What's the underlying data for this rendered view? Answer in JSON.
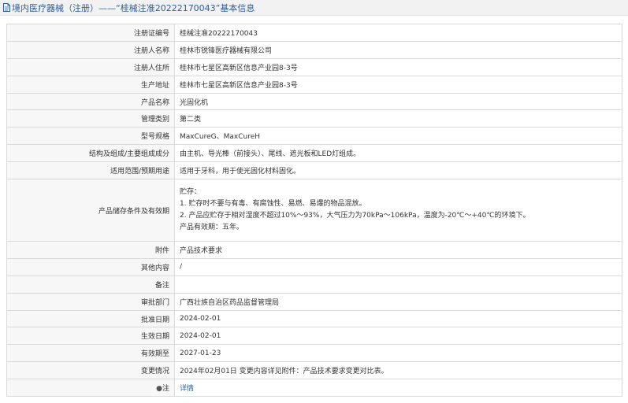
{
  "header": {
    "title": "境内医疗器械（注册）——“桂械注准20222170043”基本信息"
  },
  "rows": [
    {
      "key": "注册证编号",
      "value": "桂械注准20222170043"
    },
    {
      "key": "注册人名称",
      "value": "桂林市锐锋医疗器械有限公司"
    },
    {
      "key": "注册人住所",
      "value": "桂林市七星区高新区信息产业园8-3号"
    },
    {
      "key": "生产地址",
      "value": "桂林市七星区高新区信息产业园8-3号"
    },
    {
      "key": "产品名称",
      "value": "光固化机"
    },
    {
      "key": "管理类别",
      "value": "第二类"
    },
    {
      "key": "型号规格",
      "value": "MaxCureG、MaxCureH"
    },
    {
      "key": "结构及组成/主要组成成分",
      "value": "由主机、导光棒（前接头）、尾线、遮光板和LED灯组成。"
    },
    {
      "key": "适用范围/预期用途",
      "value": "适用于牙科，用于使光固化材料固化。"
    },
    {
      "key": "产品储存条件及有效期",
      "lines": [
        "贮存：",
        "1. 贮存时不要与有毒、有腐蚀性、易燃、易爆的物品混放。",
        "2. 产品应贮存于相对湿度不超过10%～93%，大气压力为70kPa～106kPa，温度为-20℃～+40℃的环境下。",
        "产品有效期：五年。"
      ]
    },
    {
      "key": "附件",
      "value": "产品技术要求"
    },
    {
      "key": "其他内容",
      "value": "/"
    },
    {
      "key": "备注",
      "value": ""
    },
    {
      "key": "审批部门",
      "value": "广西壮族自治区药品监督管理局"
    },
    {
      "key": "批准日期",
      "value": "2024-02-01"
    },
    {
      "key": "生效日期",
      "value": "2024-02-01"
    },
    {
      "key": "有效期至",
      "value": "2027-01-23"
    },
    {
      "key": "变更情况",
      "value": "2024年02月01日 变更内容详见附件：产品技术要求变更对比表。"
    },
    {
      "key": "注",
      "dot": "●",
      "value": "详情"
    }
  ]
}
